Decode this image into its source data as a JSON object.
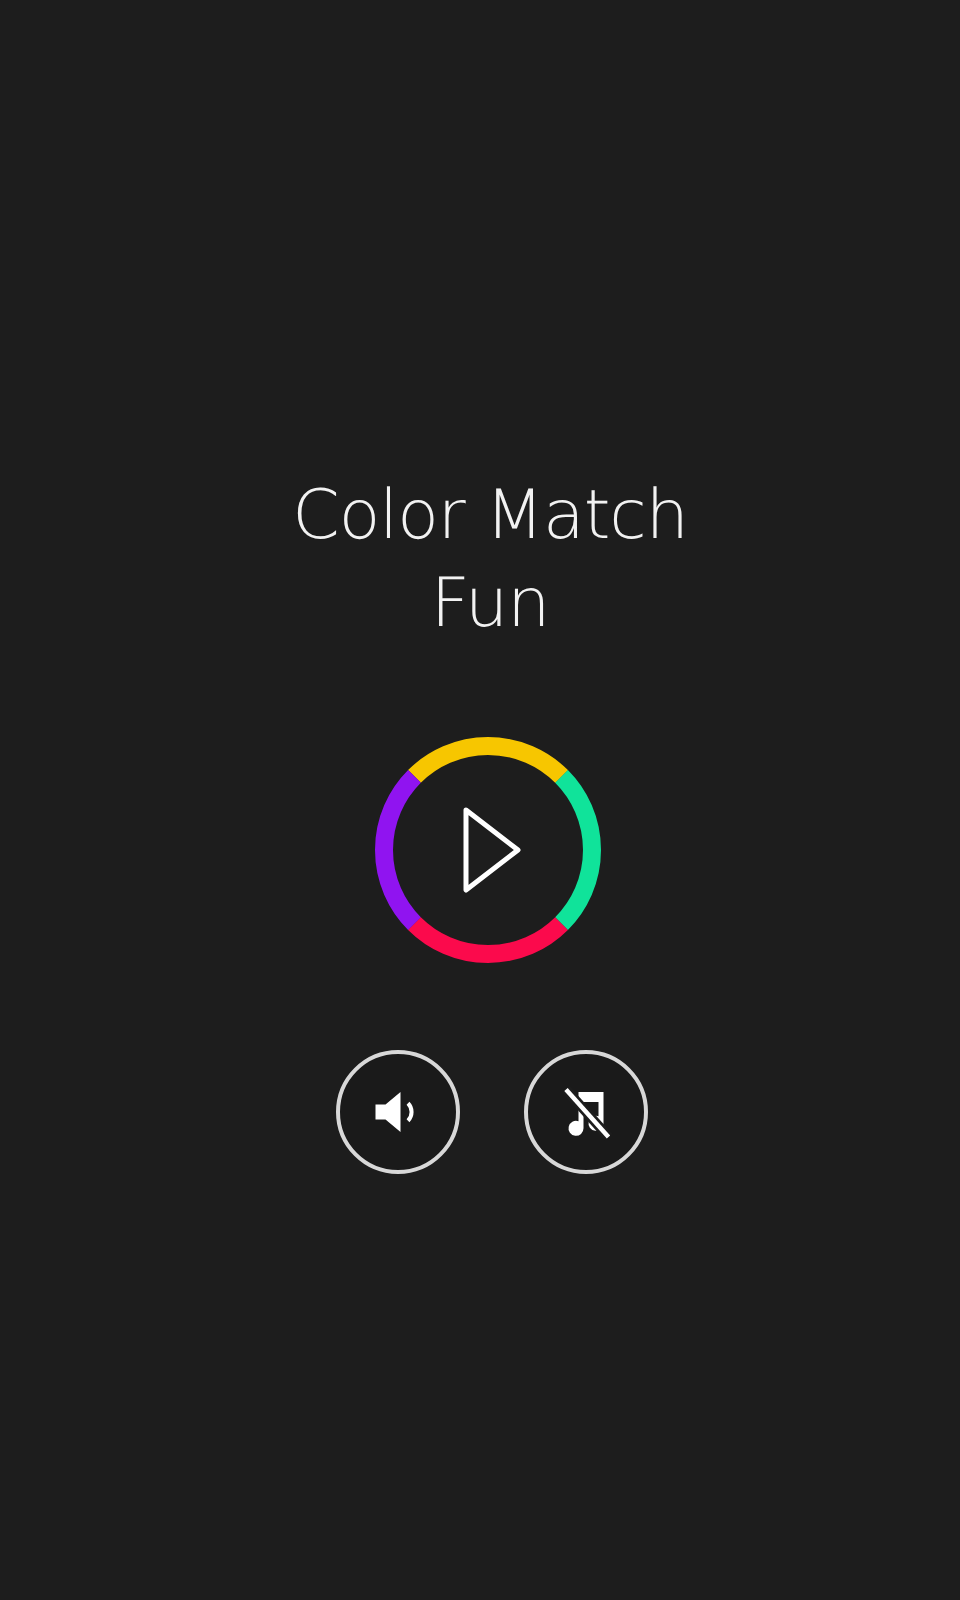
{
  "title_lines": [
    "Color Match",
    "Fun"
  ],
  "sound_on": true,
  "music_on": false
}
